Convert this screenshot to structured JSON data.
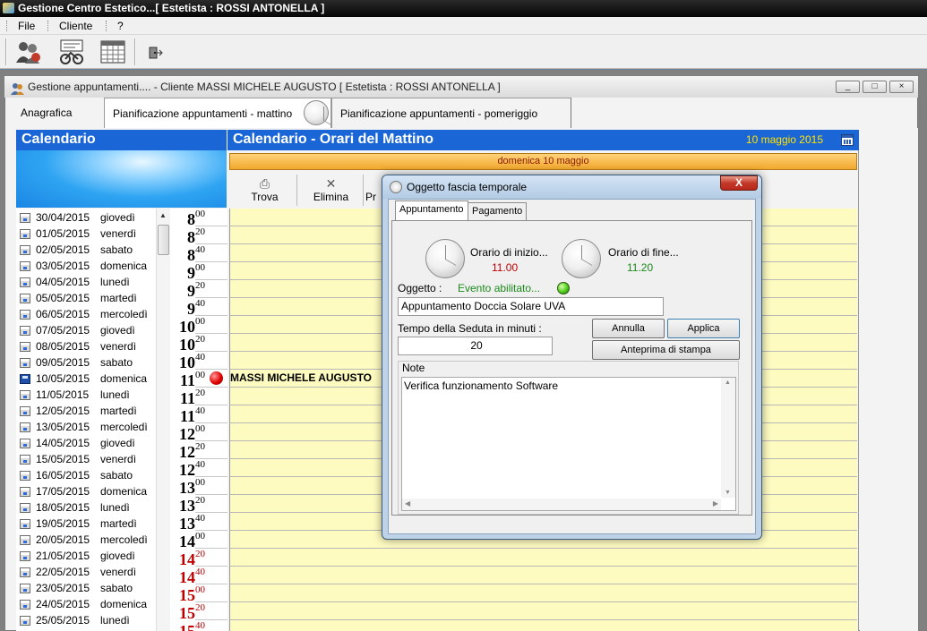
{
  "window": {
    "title": "Gestione Centro Estetico...[ Estetista : ROSSI ANTONELLA ]"
  },
  "menu": {
    "file": "File",
    "cliente": "Cliente",
    "help": "?"
  },
  "toolbar": {
    "icons": [
      "users-icon",
      "bicycle-settings-icon",
      "calendar-grid-icon",
      "exit-door-icon"
    ]
  },
  "child_window": {
    "title": "Gestione appuntamenti.... - Cliente  MASSI MICHELE AUGUSTO [ Estetista : ROSSI ANTONELLA ]",
    "min": "_",
    "max": "□",
    "close": "×"
  },
  "tabs": [
    {
      "label": "Anagrafica"
    },
    {
      "label": "Pianificazione appuntamenti  - mattino"
    },
    {
      "label": "Pianificazione appuntamenti - pomeriggio"
    }
  ],
  "calendar": {
    "title": "Calendario",
    "dates": [
      {
        "date": "30/04/2015",
        "day": "giovedì"
      },
      {
        "date": "01/05/2015",
        "day": "venerdì"
      },
      {
        "date": "02/05/2015",
        "day": "sabato"
      },
      {
        "date": "03/05/2015",
        "day": "domenica"
      },
      {
        "date": "04/05/2015",
        "day": "lunedì"
      },
      {
        "date": "05/05/2015",
        "day": "martedì"
      },
      {
        "date": "06/05/2015",
        "day": "mercoledì"
      },
      {
        "date": "07/05/2015",
        "day": "giovedì"
      },
      {
        "date": "08/05/2015",
        "day": "venerdì"
      },
      {
        "date": "09/05/2015",
        "day": "sabato"
      },
      {
        "date": "10/05/2015",
        "day": "domenica"
      },
      {
        "date": "11/05/2015",
        "day": "lunedì"
      },
      {
        "date": "12/05/2015",
        "day": "martedì"
      },
      {
        "date": "13/05/2015",
        "day": "mercoledì"
      },
      {
        "date": "14/05/2015",
        "day": "giovedì"
      },
      {
        "date": "15/05/2015",
        "day": "venerdì"
      },
      {
        "date": "16/05/2015",
        "day": "sabato"
      },
      {
        "date": "17/05/2015",
        "day": "domenica"
      },
      {
        "date": "18/05/2015",
        "day": "lunedì"
      },
      {
        "date": "19/05/2015",
        "day": "martedì"
      },
      {
        "date": "20/05/2015",
        "day": "mercoledì"
      },
      {
        "date": "21/05/2015",
        "day": "giovedì"
      },
      {
        "date": "22/05/2015",
        "day": "venerdì"
      },
      {
        "date": "23/05/2015",
        "day": "sabato"
      },
      {
        "date": "24/05/2015",
        "day": "domenica"
      },
      {
        "date": "25/05/2015",
        "day": "lunedì"
      }
    ],
    "selected_date": "10/05/2015"
  },
  "times": [
    {
      "h": "8",
      "m": "00",
      "red": false
    },
    {
      "h": "8",
      "m": "20",
      "red": false
    },
    {
      "h": "8",
      "m": "40",
      "red": false
    },
    {
      "h": "9",
      "m": "00",
      "red": false
    },
    {
      "h": "9",
      "m": "20",
      "red": false
    },
    {
      "h": "9",
      "m": "40",
      "red": false
    },
    {
      "h": "10",
      "m": "00",
      "red": false
    },
    {
      "h": "10",
      "m": "20",
      "red": false
    },
    {
      "h": "10",
      "m": "40",
      "red": false
    },
    {
      "h": "11",
      "m": "00",
      "red": false
    },
    {
      "h": "11",
      "m": "20",
      "red": false
    },
    {
      "h": "11",
      "m": "40",
      "red": false
    },
    {
      "h": "12",
      "m": "00",
      "red": false
    },
    {
      "h": "12",
      "m": "20",
      "red": false
    },
    {
      "h": "12",
      "m": "40",
      "red": false
    },
    {
      "h": "13",
      "m": "00",
      "red": false
    },
    {
      "h": "13",
      "m": "20",
      "red": false
    },
    {
      "h": "13",
      "m": "40",
      "red": false
    },
    {
      "h": "14",
      "m": "00",
      "red": false
    },
    {
      "h": "14",
      "m": "20",
      "red": true
    },
    {
      "h": "14",
      "m": "40",
      "red": true
    },
    {
      "h": "15",
      "m": "00",
      "red": true
    },
    {
      "h": "15",
      "m": "20",
      "red": true
    },
    {
      "h": "15",
      "m": "40",
      "red": true
    }
  ],
  "schedule": {
    "title": "Calendario - Orari del Mattino",
    "date_label": "10 maggio 2015",
    "day_band": "domenica 10 maggio",
    "tools": {
      "find": "Trova",
      "delete": "Elimina",
      "print_partial": "Pr"
    },
    "appointment_client": "MASSI MICHELE AUGUSTO"
  },
  "dialog": {
    "title": "Oggetto fascia temporale",
    "close": "X",
    "tabs": {
      "appointment": "Appuntamento",
      "payment": "Pagamento"
    },
    "start_label": "Orario di inizio...",
    "start_time": "11.00",
    "end_label": "Orario di fine...",
    "end_time": "11.20",
    "object_label": "Oggetto :",
    "status": "Evento abilitato...",
    "object_value": "Appuntamento Doccia Solare UVA",
    "duration_label": "Tempo della Seduta in minuti :",
    "duration_value": "20",
    "cancel": "Annulla",
    "apply": "Applica",
    "preview": "Anteprima di stampa",
    "notes_label": "Note",
    "notes_value": "Verifica funzionamento Software",
    "colors": {
      "start_time": "#c00000",
      "end_time": "#1a8a1a",
      "status": "#1a8a1a"
    }
  }
}
